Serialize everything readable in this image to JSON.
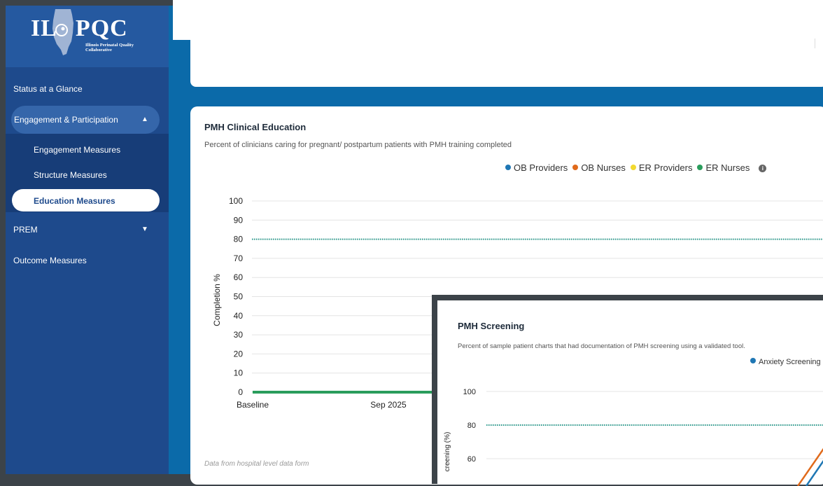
{
  "logo": {
    "text_left": "IL",
    "text_right": "PQC",
    "subtitle": "Illinois Perinatal Quality Collaborative"
  },
  "sidebar": {
    "items": [
      {
        "label": "Status at a Glance"
      },
      {
        "label": "Engagement & Participation",
        "caret": "▲"
      },
      {
        "label": "Engagement Measures"
      },
      {
        "label": "Structure Measures"
      },
      {
        "label": "Education Measures"
      },
      {
        "label": "PREM",
        "caret": "▼"
      },
      {
        "label": "Outcome Measures"
      }
    ]
  },
  "main_chart": {
    "title": "PMH Clinical Education",
    "subtitle": "Percent of clinicians caring for pregnant/ postpartum patients with PMH training completed",
    "info_icon": "i",
    "footnote": "Data from hospital level data form",
    "chart_data": {
      "type": "line",
      "ylabel": "Completion %",
      "ylim": [
        0,
        100
      ],
      "yticks": [
        "100",
        "90",
        "80",
        "70",
        "60",
        "50",
        "40",
        "30",
        "20",
        "10",
        "0"
      ],
      "categories": [
        "Baseline",
        "Sep 2025"
      ],
      "target_line": 80,
      "legend_position": "top-right",
      "series": [
        {
          "name": "OB Providers",
          "color": "#1f77b4",
          "values": [
            0,
            0
          ]
        },
        {
          "name": "OB Nurses",
          "color": "#e06a1b",
          "values": [
            0,
            0
          ]
        },
        {
          "name": "ER Providers",
          "color": "#f2d930",
          "values": [
            0,
            0
          ]
        },
        {
          "name": "ER Nurses",
          "color": "#2a9d5c",
          "values": [
            0,
            0
          ]
        }
      ]
    }
  },
  "overlay_chart": {
    "title": "PMH Screening",
    "subtitle": "Percent of sample patient charts that had documentation of PMH screening using a validated tool.",
    "chart_data": {
      "type": "line",
      "ylabel": "creening (%)",
      "ylim": [
        50,
        100
      ],
      "yticks": [
        "100",
        "80",
        "60"
      ],
      "target_line": 80,
      "legend_position": "top-right",
      "series": [
        {
          "name": "Anxiety Screening",
          "color": "#1f77b4"
        }
      ]
    }
  },
  "colors": {
    "sidebar_bg": "#1e4a8c",
    "sidebar_active": "#3566aa",
    "content_bg": "#0b6aa9",
    "target_line": "#2a9d8f"
  }
}
